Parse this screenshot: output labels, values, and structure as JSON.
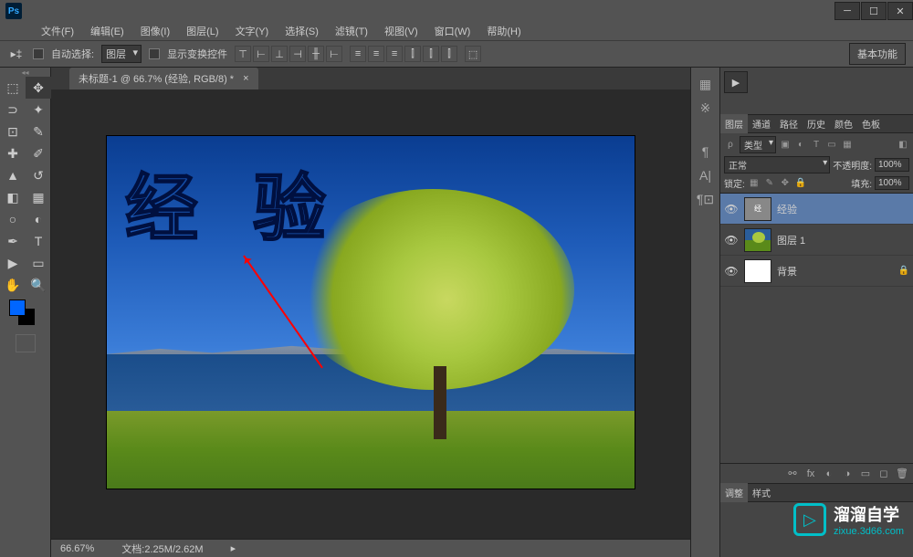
{
  "app": {
    "logo": "Ps"
  },
  "menu": {
    "file": "文件(F)",
    "edit": "编辑(E)",
    "image": "图像(I)",
    "layer": "图层(L)",
    "type": "文字(Y)",
    "select": "选择(S)",
    "filter": "滤镜(T)",
    "view": "视图(V)",
    "window": "窗口(W)",
    "help": "帮助(H)"
  },
  "options": {
    "auto_select": "自动选择:",
    "target": "图层",
    "show_transform": "显示变换控件",
    "workspace": "基本功能"
  },
  "tab": {
    "title": "未标题-1 @ 66.7% (经验, RGB/8) *"
  },
  "canvas_text": "经 验",
  "status": {
    "zoom": "66.67%",
    "doc": "文档:2.25M/2.62M"
  },
  "panels": {
    "layers": "图层",
    "channels": "通道",
    "paths": "路径",
    "history": "历史",
    "color": "颜色",
    "swatch": "色板",
    "adjustments": "调整",
    "styles": "样式"
  },
  "layer_controls": {
    "kind": "类型",
    "blend": "正常",
    "opacity_label": "不透明度:",
    "opacity": "100%",
    "lock_label": "锁定:",
    "fill_label": "填充:",
    "fill": "100%"
  },
  "layers": {
    "l1": "经验",
    "l2": "图层 1",
    "bg": "背景"
  },
  "watermark": {
    "text": "溜溜自学",
    "url": "zixue.3d66.com"
  }
}
